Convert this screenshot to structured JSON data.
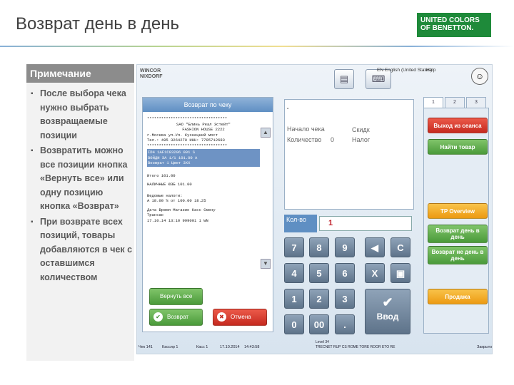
{
  "slide": {
    "title": "Возврат день в день",
    "brand": [
      "UNITED COLORS",
      "OF BENETTON."
    ]
  },
  "note": {
    "heading": "Примечание",
    "items": [
      "После выбора чека нужно выбрать возвращаемые позиции",
      "Возвратить можно все позиции кнопка «Вернуть все» или одну позицию кнопка «Возврат»",
      "При возврате всех позиций, товары добавляются в чек с оставшимся количеством"
    ]
  },
  "pos": {
    "vendor": [
      "WINCOR",
      "NIXDORF"
    ],
    "language": "EN English (United States)",
    "help": "Help",
    "receipt": {
      "header": "Возврат по чеку",
      "lines": [
        "**********************************",
        "SAO \"Блинь Реал Эстейт\"",
        "FASHION HOUSE        2222",
        "г.Москва ул.Ул. Кузнецкий мост",
        "Тел.: 495 3264270 ИНН: 7705712683",
        "**********************************"
      ],
      "highlight": [
        "ID4 1AF1C83206 001 S",
        "ВОЙДИ ЗА   1/1          101.00 А",
        "Возврат  1       Цвет   3XX"
      ],
      "totals": [
        "Итого                 101.00",
        "НАЛИЧНЫЕ      ЮЗБ    101.00",
        "Ведомые налоги:",
        "А    18.00 % от     100.00     18.25"
      ],
      "footer": [
        "Дата   Время  Магазин Касс Смену",
        "Трансак",
        "17.10.14 13:10 999001   1 WN"
      ]
    },
    "info": {
      "receipt_start_label": "Начало чека",
      "quantity_label": "Количество",
      "quantity_value": "0",
      "discount_label": "Скидк",
      "tax_label": "Налог"
    },
    "qty": {
      "label": "Кол-во",
      "value": "1"
    },
    "keypad": {
      "k7": "7",
      "k8": "8",
      "k9": "9",
      "k4": "4",
      "k5": "5",
      "k6": "6",
      "k1": "1",
      "k2": "2",
      "k3": "3",
      "k0": "0",
      "k00": "00",
      "kdot": ".",
      "clear": "C",
      "cancel": "X",
      "enter": "Ввод"
    },
    "tabs": [
      "1",
      "2",
      "3"
    ],
    "side": {
      "logout": "Выход из сеанса",
      "find": "Найти товар",
      "tp_overview": "TP Overview",
      "return_same_day": "Возврат день в день",
      "return_other_day": "Возврат не день в день",
      "sale": "Продажа"
    },
    "actions": {
      "return_all": "Вернуть все",
      "return": "Возврат",
      "cancel": "Отмена"
    },
    "status": {
      "receipt": "Чек 141",
      "cashier": "Кассир  1",
      "till": "Касс 1",
      "date": "17.10.2014",
      "time": "14:43:58",
      "level": "Level 34",
      "store": "TRECNET RUP CS ROME TORE ROOR ETO RE",
      "closed": "Закрыто"
    },
    "colors": {
      "accent_blue": "#5f8fc3",
      "red_button": "#d93a2d",
      "green_button": "#5aa846",
      "orange_button": "#f2ad2a"
    }
  }
}
